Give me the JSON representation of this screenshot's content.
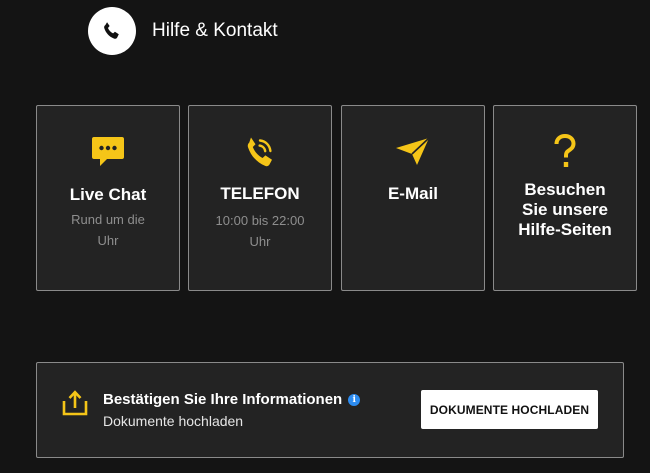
{
  "header": {
    "title": "Hilfe & Kontakt",
    "icon": "phone-icon"
  },
  "colors": {
    "accent": "#f5c518",
    "background": "#141414",
    "card": "#232323",
    "info": "#2d8cf0"
  },
  "cards": [
    {
      "title": "Live Chat",
      "subtitle_line1": "Rund um die",
      "subtitle_line2": "Uhr",
      "icon": "chat-bubble-icon"
    },
    {
      "title": "TELEFON",
      "subtitle_line1": "10:00 bis 22:00",
      "subtitle_line2": "Uhr",
      "icon": "phone-icon"
    },
    {
      "title": "E-Mail",
      "icon": "paper-plane-icon"
    },
    {
      "title_line1": "Besuchen",
      "title_line2": "Sie unsere",
      "title_line3": "Hilfe-Seiten",
      "icon": "question-mark-icon"
    }
  ],
  "banner": {
    "title": "Bestätigen Sie Ihre Informationen",
    "subtitle": "Dokumente hochladen",
    "button_label": "DOKUMENTE HOCHLADEN",
    "icon": "upload-icon"
  }
}
